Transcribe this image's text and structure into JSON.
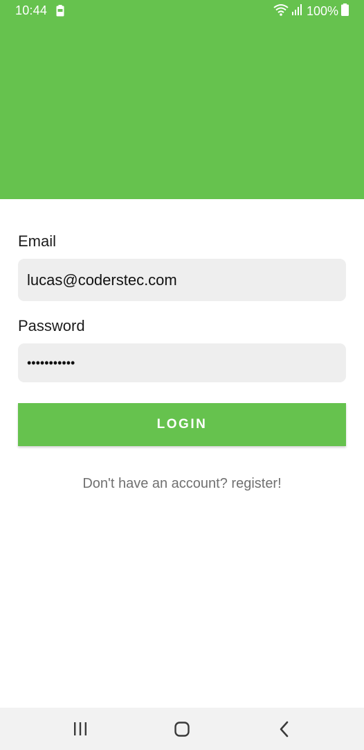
{
  "status_bar": {
    "time": "10:44",
    "battery_percent": "100%"
  },
  "colors": {
    "accent": "#66c24e",
    "field_background": "#eeeeee",
    "nav_background": "#f2f2f2",
    "muted_text": "#707070"
  },
  "form": {
    "email_label": "Email",
    "email_value": "lucas@coderstec.com",
    "password_label": "Password",
    "password_value": "•••••••••••"
  },
  "login_button": {
    "label": "LOGIN"
  },
  "register_link": {
    "label": "Don't have an account? register!"
  },
  "nav_bar": {
    "icons": [
      "recent-apps-icon",
      "home-icon",
      "back-icon"
    ]
  }
}
